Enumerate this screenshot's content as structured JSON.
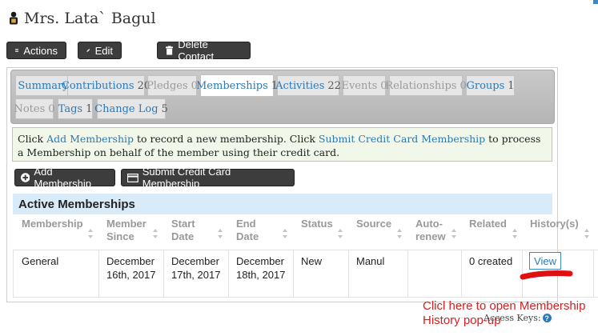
{
  "contact": {
    "name": "Mrs. Lata` Bagul",
    "icon": "person-icon"
  },
  "toolbar": {
    "actions": "Actions",
    "edit": "Edit",
    "delete": "Delete Contact"
  },
  "tabs": [
    {
      "label": "Summary",
      "count": "",
      "state": "normal"
    },
    {
      "label": "Contributions",
      "count": "20",
      "state": "normal"
    },
    {
      "label": "Pledges",
      "count": "0",
      "state": "disabled"
    },
    {
      "label": "Memberships",
      "count": "1",
      "state": "active"
    },
    {
      "label": "Activities",
      "count": "22",
      "state": "normal"
    },
    {
      "label": "Events",
      "count": "0",
      "state": "disabled"
    },
    {
      "label": "Relationships",
      "count": "0",
      "state": "disabled"
    },
    {
      "label": "Groups",
      "count": "1",
      "state": "normal"
    },
    {
      "label": "Notes",
      "count": "0",
      "state": "disabled"
    },
    {
      "label": "Tags",
      "count": "1",
      "state": "normal"
    },
    {
      "label": "Change Log",
      "count": "5",
      "state": "normal"
    }
  ],
  "help": {
    "t1": "Click ",
    "l1": "Add Membership",
    "t2": " to record a new membership. Click ",
    "l2": "Submit Credit Card Membership",
    "t3": " to process a Membership on behalf of the member using their credit card."
  },
  "buttons": {
    "add": "Add Membership",
    "submit": "Submit Credit Card Membership"
  },
  "section_title": "Active Memberships",
  "columns": [
    "Membership",
    "Member Since",
    "Start Date",
    "End Date",
    "Status",
    "Source",
    "Auto-renew",
    "Related",
    "History(s)"
  ],
  "row": {
    "membership": "General",
    "member_since": "December 16th, 2017",
    "start_date": "December 17th, 2017",
    "end_date": "December 18th, 2017",
    "status": "New",
    "source": "Manul",
    "auto_renew": "",
    "related": "0 created",
    "history": "View"
  },
  "annotation": "Clicl here to open Membership History pop-up",
  "access_keys": "Access Keys:",
  "colors": {
    "accent": "#2a79b8",
    "annotation": "#d42020",
    "section": "#d9eaf8"
  }
}
